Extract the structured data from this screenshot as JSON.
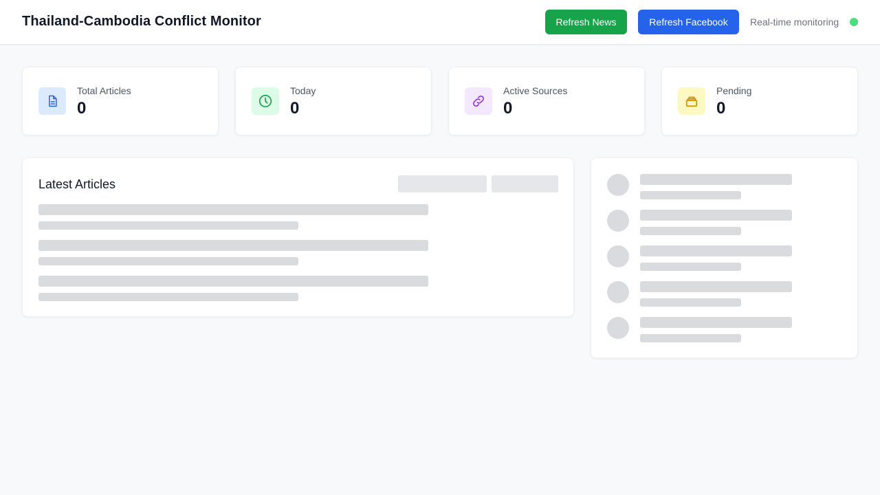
{
  "header": {
    "title": "Thailand-Cambodia Conflict Monitor",
    "refresh_news_label": "Refresh News",
    "refresh_facebook_label": "Refresh Facebook",
    "status_text": "Real-time monitoring"
  },
  "stats": [
    {
      "label": "Total Articles",
      "value": "0",
      "icon": "document-icon"
    },
    {
      "label": "Today",
      "value": "0",
      "icon": "clock-icon"
    },
    {
      "label": "Active Sources",
      "value": "0",
      "icon": "link-icon"
    },
    {
      "label": "Pending",
      "value": "0",
      "icon": "inbox-stack-icon"
    }
  ],
  "articles": {
    "title": "Latest Articles"
  },
  "colors": {
    "news_button": "#16a34a",
    "facebook_button": "#2563eb",
    "status_dot": "#4ade80",
    "skeleton": "#d9dbdf"
  }
}
